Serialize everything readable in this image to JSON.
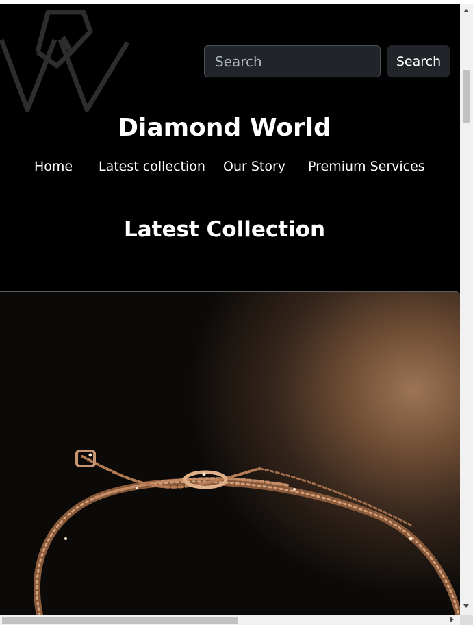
{
  "header": {
    "logo_icon": "diamond-w-logo",
    "search": {
      "placeholder": "Search",
      "button_label": "Search"
    },
    "site_title": "Diamond World"
  },
  "nav": {
    "items": [
      {
        "label": "Home"
      },
      {
        "label": "Latest collection"
      },
      {
        "label": "Our Story"
      },
      {
        "label": "Premium Services"
      }
    ]
  },
  "main": {
    "section_title": "Latest Collection",
    "feature_image": "rose-gold-diamond-bracelet"
  },
  "colors": {
    "background": "#000000",
    "text": "#ffffff",
    "control": "#212529"
  },
  "scrollbars": {
    "vertical": "scrollbar",
    "horizontal": "scrollbar"
  }
}
